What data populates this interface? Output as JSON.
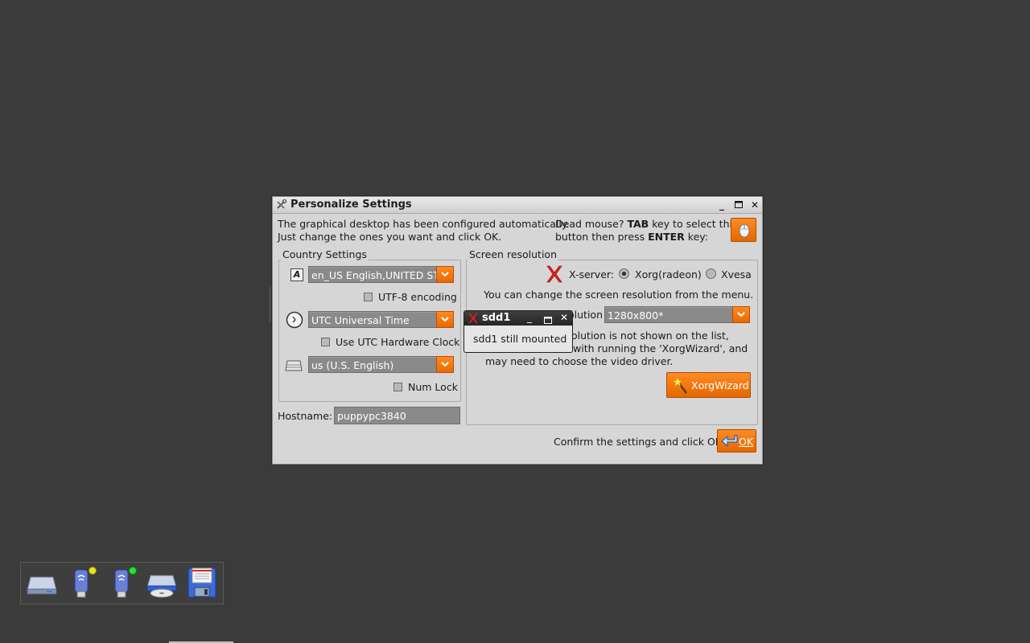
{
  "dialog": {
    "title": "Personalize Settings",
    "intro_line1": "The graphical desktop has been configured automatically.",
    "intro_line2": "Just change the ones you want and click OK.",
    "dead_mouse_prefix": "Dead mouse? ",
    "dead_mouse_tab": "TAB",
    "dead_mouse_mid": " key to select this",
    "dead_mouse_line2_prefix": "button then press ",
    "dead_mouse_enter": "ENTER",
    "dead_mouse_line2_suffix": " key:",
    "country": {
      "label": "Country Settings",
      "locale_value": "en_US English,UNITED STATES",
      "utf8_label": "UTF-8 encoding",
      "utf8_checked": false,
      "timezone_value": "UTC Universal Time",
      "utc_clock_label": "Use UTC Hardware Clock",
      "utc_clock_checked": false,
      "keyboard_value": "us (U.S. English)",
      "numlock_label": "Num Lock",
      "numlock_checked": false
    },
    "screen": {
      "label": "Screen resolution",
      "xserver_label": "X-server:",
      "xorg_option": "Xorg(radeon)",
      "xvesa_option": "Xvesa",
      "selected_server": "Xorg(radeon)",
      "change_text": "You can change the screen resolution from the menu.",
      "resolution_label": "olution",
      "resolution_value": "1280x800*",
      "note_line1": "olution is not shown on the list,",
      "note_line2": "with running the 'XorgWizard', and",
      "note_line3": "may need to choose the video driver.",
      "wizard_button": "XorgWizard"
    },
    "hostname_label": "Hostname:",
    "hostname_value": "puppypc3840",
    "confirm_text": "Confirm the settings and click OK.",
    "ok_button": "OK"
  },
  "popup": {
    "title": "sdd1",
    "message": "sdd1 still mounted"
  },
  "drives": [
    "drive-icon",
    "usb-drive-icon",
    "usb-drive-icon",
    "optical-drive-icon",
    "floppy-icon"
  ],
  "colors": {
    "desktop": "#3b3b3b",
    "accent": "#f07800",
    "dialog_bg": "#d6d6d6"
  }
}
